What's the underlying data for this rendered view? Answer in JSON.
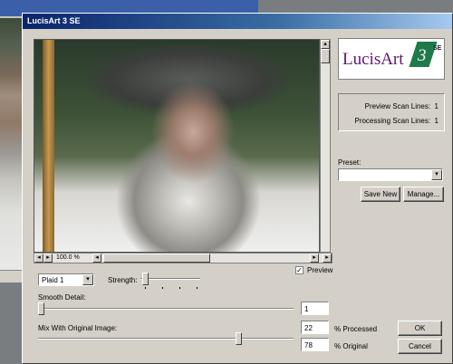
{
  "window": {
    "title": "LucisArt 3 SE"
  },
  "logo": {
    "brand_text": "LucisArt",
    "version_text": "3",
    "edition_text": "SE"
  },
  "preview": {
    "zoom": "100.0 %",
    "preview_label": "Preview",
    "preview_checked": true
  },
  "info": {
    "preview_scan_label": "Preview Scan Lines:",
    "preview_scan_value": "1",
    "processing_scan_label": "Processing Scan Lines:",
    "processing_scan_value": "1"
  },
  "preset": {
    "label": "Preset:",
    "value": "",
    "save_new_label": "Save New",
    "manage_label": "Manage..."
  },
  "effect": {
    "selected": "Plaid 1",
    "strength_label": "Strength:"
  },
  "smooth": {
    "label": "Smooth Detail:",
    "value": "1",
    "level": 0.0
  },
  "mix": {
    "label": "Mix With Original Image:",
    "processed_value": "22",
    "processed_label": "% Processed",
    "original_value": "78",
    "original_label": "% Original",
    "level": 0.78
  },
  "buttons": {
    "ok": "OK",
    "cancel": "Cancel"
  },
  "colors": {
    "title_start": "#0a246a",
    "logo_purple": "#5a1a6e",
    "logo_green": "#1f7a4a"
  }
}
